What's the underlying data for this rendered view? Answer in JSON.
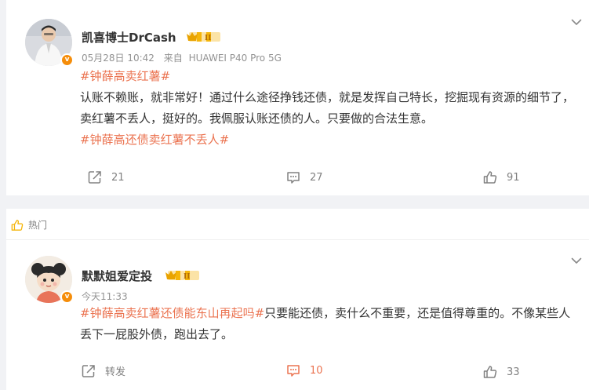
{
  "post": {
    "author": "凯喜博士DrCash",
    "level_badge": "II",
    "verified_badge": "v",
    "time": "05月28日 10:42",
    "source_prefix": "来自",
    "source": "HUAWEI P40 Pro 5G",
    "topic_tag": "#钟薛高卖红薯#",
    "body": "认账不赖账，就非常好！通过什么途径挣钱还债，就是发挥自己特长，挖掘现有资源的细节了，卖红薯不丢人，挺好的。我佩服认账还债的人。只要做的合法生意。",
    "footer_tag": "#钟薛高还债卖红薯不丢人#",
    "repost_count": "21",
    "comment_count": "27",
    "like_count": "91",
    "icons": [
      "avatar",
      "verified-badge",
      "level-badge",
      "chevron-down-icon",
      "repost-icon",
      "comment-icon",
      "like-icon"
    ]
  },
  "hot_section": {
    "label": "热门",
    "icon": "thumbs-up-outline-icon"
  },
  "comment": {
    "author": "默默姐爱定投",
    "level_badge": "II",
    "verified_badge": "v",
    "time": "今天11:33",
    "topic_tag": "#钟薛高卖红薯还债能东山再起吗#",
    "body": "只要能还债，卖什么不重要，还是值得尊重的。不像某些人丢下一屁股外债，跑出去了。",
    "repost_label": "转发",
    "comment_count": "10",
    "like_count": "33"
  },
  "colors": {
    "accent": "#eb7350",
    "badge_gold": "#f5b50a",
    "meta_gray": "#939393",
    "background": "#f1f2f5"
  }
}
